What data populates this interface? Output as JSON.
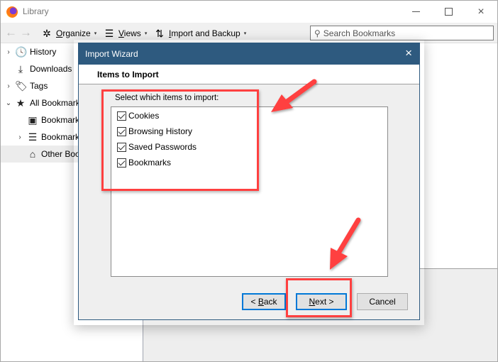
{
  "window": {
    "title": "Library",
    "controls": {
      "minimize": "minimize",
      "maximize": "maximize",
      "close": "×"
    }
  },
  "toolbar": {
    "back_icon": "←",
    "forward_icon": "→",
    "organize": {
      "icon": "✲",
      "label_ul": "O",
      "label_rest": "rganize",
      "caret": "▾"
    },
    "views": {
      "icon": "☰",
      "label_ul": "V",
      "label_rest": "iews",
      "caret": "▾"
    },
    "import_backup": {
      "icon": "⇅",
      "label_ul": "I",
      "label_rest": "mport and Backup",
      "caret": "▾"
    },
    "search": {
      "icon": "⚲",
      "placeholder": "Search Bookmarks",
      "value": ""
    }
  },
  "sidebar": {
    "items": [
      {
        "label": "History",
        "icon": "history-icon",
        "glyph": "🕓",
        "twisty": "›",
        "expanded": false
      },
      {
        "label": "Downloads",
        "icon": "download-icon",
        "glyph": "⤓",
        "twisty": "",
        "expanded": false
      },
      {
        "label": "Tags",
        "icon": "tag-icon",
        "glyph": "🏷",
        "twisty": "›",
        "expanded": false
      },
      {
        "label": "All Bookmarks",
        "icon": "star-icon",
        "glyph": "★",
        "twisty": "⌄",
        "expanded": true
      },
      {
        "label": "Bookmarks Toolbar",
        "icon": "bookmarks-toolbar-icon",
        "glyph": "▣",
        "twisty": "",
        "expanded": false
      },
      {
        "label": "Bookmarks Menu",
        "icon": "bookmarks-menu-icon",
        "glyph": "☰",
        "twisty": "›",
        "expanded": false
      },
      {
        "label": "Other Bookmarks",
        "icon": "other-bookmarks-icon",
        "glyph": "⌂",
        "twisty": "",
        "expanded": false,
        "selected": true
      }
    ]
  },
  "dialog": {
    "title": "Import Wizard",
    "close_icon": "×",
    "header": "Items to Import",
    "select_label": "Select which items to import:",
    "items": [
      {
        "label": "Cookies",
        "checked": true
      },
      {
        "label": "Browsing History",
        "checked": true
      },
      {
        "label": "Saved Passwords",
        "checked": true
      },
      {
        "label": "Bookmarks",
        "checked": true
      }
    ],
    "buttons": {
      "back": {
        "prefix": "< ",
        "ul": "B",
        "rest": "ack"
      },
      "next": {
        "ul": "N",
        "rest": "ext >"
      },
      "cancel": "Cancel"
    }
  },
  "annotations": {
    "color": "#ff4040"
  }
}
